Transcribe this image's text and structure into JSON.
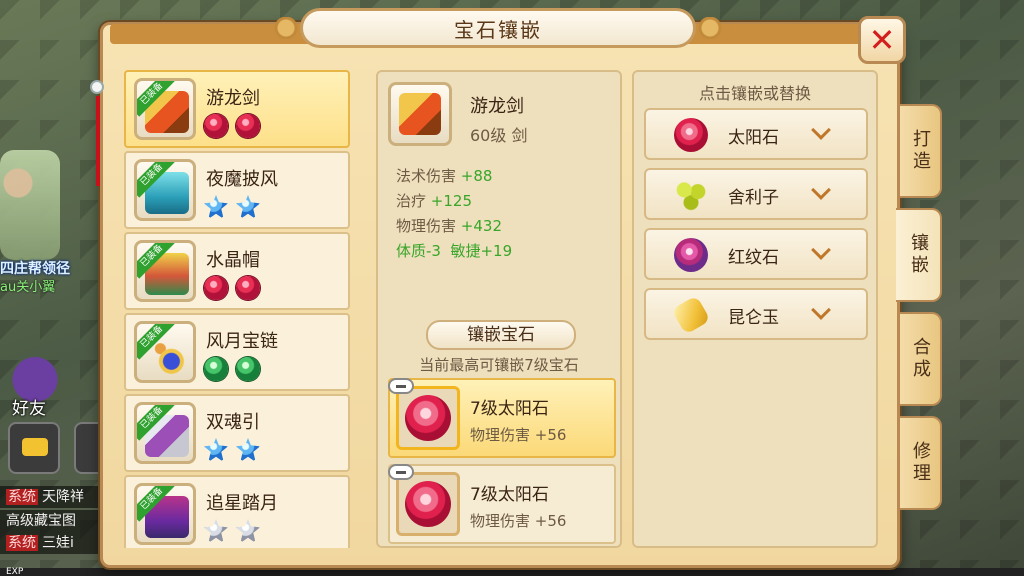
{
  "window": {
    "title": "宝石镶嵌"
  },
  "background": {
    "guild_text": "四庄帮领径",
    "guild_sub": "au关小翼",
    "friend_label": "好友",
    "system_messages": [
      {
        "tag": "系统",
        "text": "天降祥"
      },
      {
        "tag": "",
        "text": "高级藏宝图"
      },
      {
        "tag": "系统",
        "text": "三娃i"
      }
    ],
    "exp_label": "EXP"
  },
  "equipment": [
    {
      "name": "游龙剑",
      "badge": "已装备",
      "gems": [
        "red",
        "red"
      ],
      "art": "sword",
      "selected": true
    },
    {
      "name": "夜魔披风",
      "badge": "已装备",
      "gems": [
        "blue",
        "blue"
      ],
      "art": "cloak"
    },
    {
      "name": "水晶帽",
      "badge": "已装备",
      "gems": [
        "red",
        "red"
      ],
      "art": "hat"
    },
    {
      "name": "风月宝链",
      "badge": "已装备",
      "gems": [
        "green",
        "green"
      ],
      "art": "necklace"
    },
    {
      "name": "双魂引",
      "badge": "已装备",
      "gems": [
        "blue",
        "blue"
      ],
      "art": "belt"
    },
    {
      "name": "追星踏月",
      "badge": "已装备",
      "gems": [
        "white",
        "white"
      ],
      "art": "boots"
    }
  ],
  "detail": {
    "name": "游龙剑",
    "level": "60级 剑",
    "stats": [
      {
        "label": "法术伤害",
        "value": "+88"
      },
      {
        "label": "治疗",
        "value": "+125"
      },
      {
        "label": "物理伤害",
        "value": "+432"
      }
    ],
    "bonus": "体质-3  敏捷+19",
    "section_title": "镶嵌宝石",
    "section_sub": "当前最高可镶嵌7级宝石",
    "slots": [
      {
        "name": "7级太阳石",
        "stat_label": "物理伤害",
        "stat_value": "+56",
        "selected": true
      },
      {
        "name": "7级太阳石",
        "stat_label": "物理伤害",
        "stat_value": "+56",
        "selected": false
      }
    ]
  },
  "options": {
    "title": "点击镶嵌或替换",
    "items": [
      {
        "label": "太阳石",
        "icon": "sun-stone-icon"
      },
      {
        "label": "舍利子",
        "icon": "relic-icon"
      },
      {
        "label": "红纹石",
        "icon": "red-pattern-stone-icon"
      },
      {
        "label": "昆仑玉",
        "icon": "kunlun-jade-icon"
      }
    ]
  },
  "tabs": [
    {
      "label": "打造",
      "active": false
    },
    {
      "label": "镶嵌",
      "active": true
    },
    {
      "label": "合成",
      "active": false
    },
    {
      "label": "修理",
      "active": false
    }
  ],
  "colors": {
    "accent_green": "#39a52a",
    "close_red": "#d41d1d",
    "panel_border": "#b88952"
  }
}
